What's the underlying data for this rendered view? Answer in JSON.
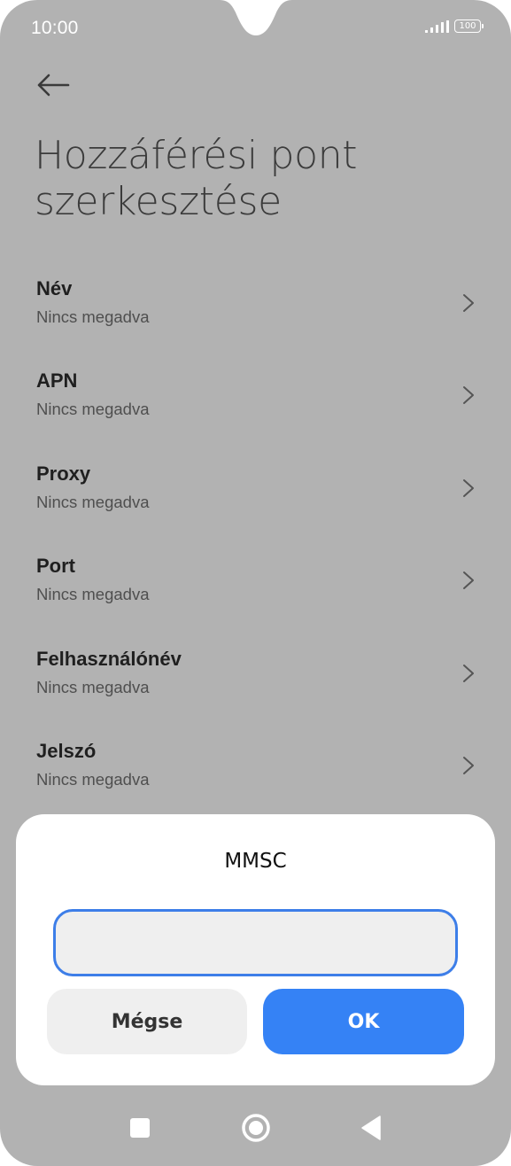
{
  "status_bar": {
    "time": "10:00",
    "battery_level": "100"
  },
  "header": {
    "title": "Hozzáférési pont szerkesztése"
  },
  "settings": [
    {
      "label": "Név",
      "value": "Nincs megadva"
    },
    {
      "label": "APN",
      "value": "Nincs megadva"
    },
    {
      "label": "Proxy",
      "value": "Nincs megadva"
    },
    {
      "label": "Port",
      "value": "Nincs megadva"
    },
    {
      "label": "Felhasználónév",
      "value": "Nincs megadva"
    },
    {
      "label": "Jelszó",
      "value": "Nincs megadva"
    }
  ],
  "dialog": {
    "title": "MMSC",
    "input_value": "",
    "cancel_label": "Mégse",
    "ok_label": "OK"
  },
  "icons": {
    "back": "arrow-left-icon",
    "chevron": "chevron-right-icon",
    "signal": "signal-icon",
    "battery": "battery-icon",
    "recents": "square-icon",
    "home": "circle-icon",
    "nav_back": "triangle-back-icon"
  },
  "colors": {
    "background": "#b2b2b2",
    "accent": "#3582f5",
    "input_border": "#3d7ee8",
    "dialog_bg": "#ffffff"
  }
}
